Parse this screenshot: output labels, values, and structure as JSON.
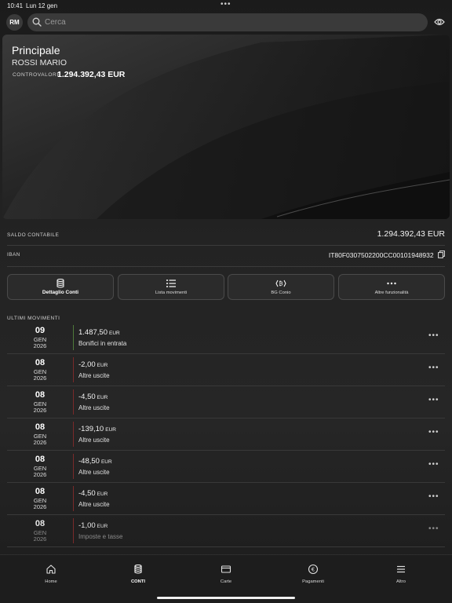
{
  "status_bar": {
    "time": "10:41",
    "date": "Lun 12 gen",
    "dots": "•••"
  },
  "top_bar": {
    "avatar_initials": "RM",
    "search_placeholder": "Cerca"
  },
  "account": {
    "title": "Principale",
    "holder": "ROSSI MARIO",
    "countervalue_label": "CONTROVALORE",
    "countervalue": "1.294.392,43 EUR"
  },
  "balance": {
    "label": "SALDO CONTABILE",
    "value": "1.294.392,43 EUR"
  },
  "iban": {
    "label": "IBAN",
    "value": "IT80F0307502200CC00101948932"
  },
  "actions": [
    {
      "label": "Dettaglio Conti",
      "icon": "database-icon",
      "active": true
    },
    {
      "label": "Lista movimenti",
      "icon": "list-icon"
    },
    {
      "label": "BG Conio",
      "icon": "bitcoin-icon"
    },
    {
      "label": "Altre funzionalità",
      "icon": "more-icon"
    }
  ],
  "movements_title": "ULTIMI MOVIMENTI",
  "movements": [
    {
      "day": "09",
      "month": "GEN",
      "year": "2026",
      "amount": "1.487,50",
      "currency": "EUR",
      "category": "Bonifici in entrata",
      "type": "in"
    },
    {
      "day": "08",
      "month": "GEN",
      "year": "2026",
      "amount": "-2,00",
      "currency": "EUR",
      "category": "Altre uscite",
      "type": "out"
    },
    {
      "day": "08",
      "month": "GEN",
      "year": "2026",
      "amount": "-4,50",
      "currency": "EUR",
      "category": "Altre uscite",
      "type": "out"
    },
    {
      "day": "08",
      "month": "GEN",
      "year": "2026",
      "amount": "-139,10",
      "currency": "EUR",
      "category": "Altre uscite",
      "type": "out"
    },
    {
      "day": "08",
      "month": "GEN",
      "year": "2026",
      "amount": "-48,50",
      "currency": "EUR",
      "category": "Altre uscite",
      "type": "out"
    },
    {
      "day": "08",
      "month": "GEN",
      "year": "2026",
      "amount": "-4,50",
      "currency": "EUR",
      "category": "Altre uscite",
      "type": "out"
    },
    {
      "day": "08",
      "month": "GEN",
      "year": "2026",
      "amount": "-1,00",
      "currency": "EUR",
      "category": "Imposte e tasse",
      "type": "out"
    }
  ],
  "tabs": [
    {
      "label": "Home",
      "icon": "home-icon"
    },
    {
      "label": "CONTI",
      "icon": "database-icon",
      "active": true
    },
    {
      "label": "Carte",
      "icon": "card-icon"
    },
    {
      "label": "Pagamenti",
      "icon": "euro-icon"
    },
    {
      "label": "Altro",
      "icon": "menu-icon"
    }
  ],
  "colors": {
    "income_bar": "#4f7a3a",
    "expense_bar": "#7a2a2a",
    "background": "#222222"
  }
}
